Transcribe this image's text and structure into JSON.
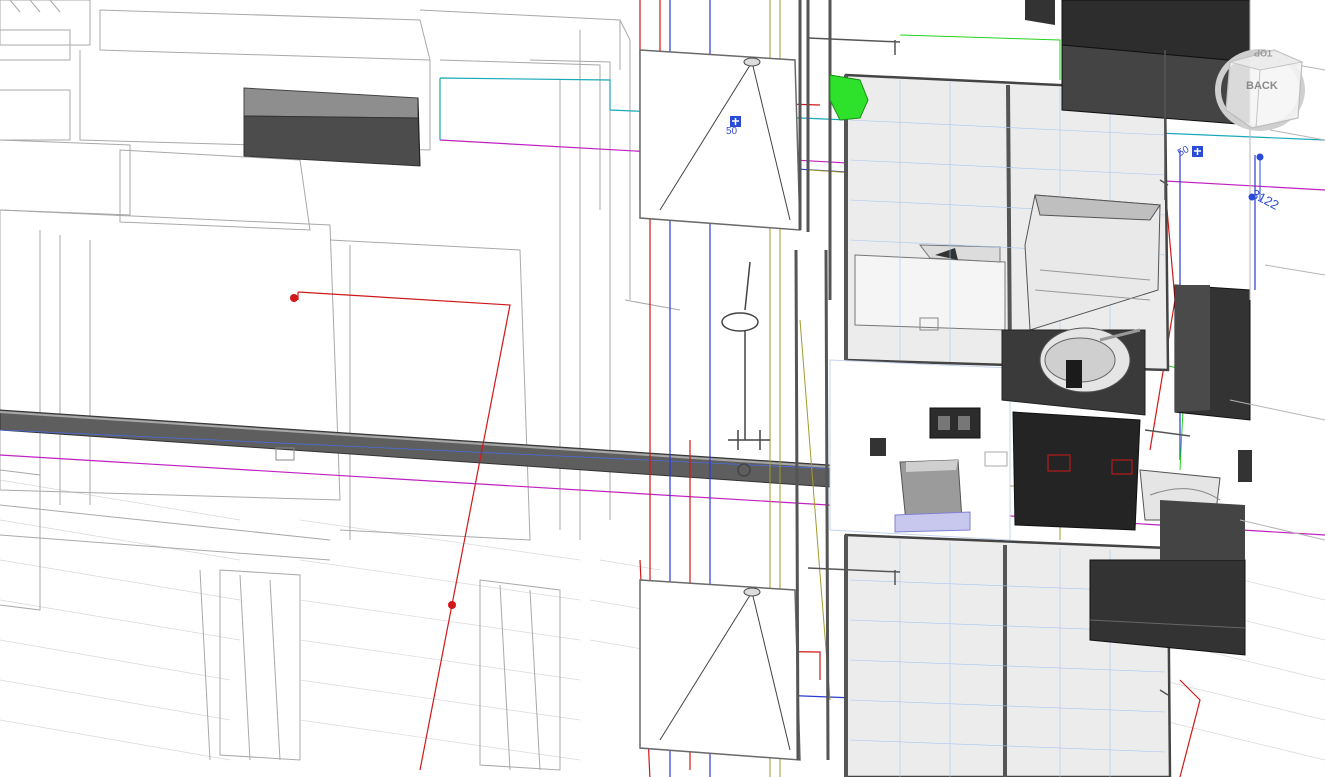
{
  "view": {
    "type": "3D model viewport",
    "style": "hidden-line / shaded mix"
  },
  "viewcube": {
    "face_front": "BACK",
    "face_top": "TOP"
  },
  "dimension": {
    "value": "3122"
  },
  "tags": {
    "tag_a": "50",
    "tag_b": "50"
  },
  "colors": {
    "pipe_gray": "#6d6d6d",
    "water_supply": "#d01818",
    "drainage": "#2a3bd0",
    "vent_green": "#26d41e",
    "magenta_line": "#c020c0",
    "cyan_line": "#1aa8b8",
    "olive_line": "#a39a2e"
  },
  "icons": [
    "viewcube-icon",
    "fixture-tag-icon"
  ]
}
